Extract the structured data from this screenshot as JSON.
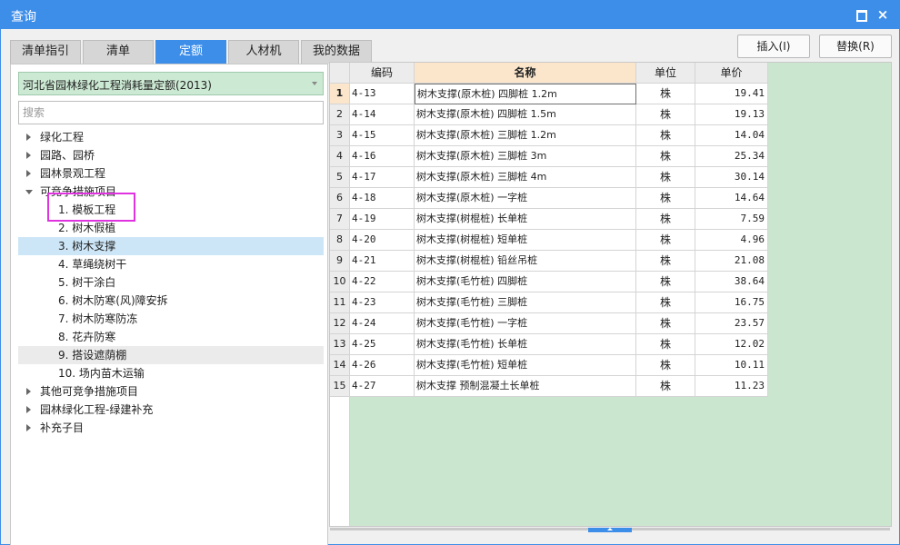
{
  "window": {
    "title": "查询",
    "maximize_icon": "maximize-icon",
    "close_icon": "close-icon",
    "close_glyph": "×"
  },
  "tabs": [
    {
      "label": "清单指引",
      "active": false
    },
    {
      "label": "清单",
      "active": false
    },
    {
      "label": "定额",
      "active": true
    },
    {
      "label": "人材机",
      "active": false
    },
    {
      "label": "我的数据",
      "active": false
    }
  ],
  "actions": {
    "insert_label": "插入(I)",
    "replace_label": "替换(R)"
  },
  "library": {
    "selected": "河北省园林绿化工程消耗量定额(2013)"
  },
  "search": {
    "placeholder": "搜索",
    "value": ""
  },
  "tree": [
    {
      "label": "绿化工程",
      "level": 0,
      "state": "collapsed"
    },
    {
      "label": "园路、园桥",
      "level": 0,
      "state": "collapsed"
    },
    {
      "label": "园林景观工程",
      "level": 0,
      "state": "collapsed"
    },
    {
      "label": "可竞争措施项目",
      "level": 0,
      "state": "expanded"
    },
    {
      "label": "1. 模板工程",
      "level": 1
    },
    {
      "label": "2. 树木假植",
      "level": 1
    },
    {
      "label": "3. 树木支撑",
      "level": 1,
      "selected": true
    },
    {
      "label": "4. 草绳绕树干",
      "level": 1
    },
    {
      "label": "5. 树干涂白",
      "level": 1
    },
    {
      "label": "6. 树木防寒(风)障安拆",
      "level": 1
    },
    {
      "label": "7. 树木防寒防冻",
      "level": 1
    },
    {
      "label": "8. 花卉防寒",
      "level": 1
    },
    {
      "label": "9. 搭设遮荫棚",
      "level": 1,
      "hover": true
    },
    {
      "label": "10. 场内苗木运输",
      "level": 1
    },
    {
      "label": "其他可竞争措施项目",
      "level": 0,
      "state": "collapsed"
    },
    {
      "label": "园林绿化工程-绿建补充",
      "level": 0,
      "state": "collapsed"
    },
    {
      "label": "补充子目",
      "level": 0,
      "state": "collapsed"
    }
  ],
  "grid": {
    "columns": [
      "编码",
      "名称",
      "单位",
      "单价"
    ],
    "current_row": 1,
    "rows": [
      {
        "no": "1",
        "code": "4-13",
        "name": "树木支撑(原木桩) 四脚桩 1.2m",
        "unit": "株",
        "price": "19.41"
      },
      {
        "no": "2",
        "code": "4-14",
        "name": "树木支撑(原木桩) 四脚桩 1.5m",
        "unit": "株",
        "price": "19.13"
      },
      {
        "no": "3",
        "code": "4-15",
        "name": "树木支撑(原木桩) 三脚桩 1.2m",
        "unit": "株",
        "price": "14.04"
      },
      {
        "no": "4",
        "code": "4-16",
        "name": "树木支撑(原木桩) 三脚桩 3m",
        "unit": "株",
        "price": "25.34"
      },
      {
        "no": "5",
        "code": "4-17",
        "name": "树木支撑(原木桩) 三脚桩 4m",
        "unit": "株",
        "price": "30.14"
      },
      {
        "no": "6",
        "code": "4-18",
        "name": "树木支撑(原木桩) 一字桩",
        "unit": "株",
        "price": "14.64"
      },
      {
        "no": "7",
        "code": "4-19",
        "name": "树木支撑(树棍桩) 长单桩",
        "unit": "株",
        "price": "7.59"
      },
      {
        "no": "8",
        "code": "4-20",
        "name": "树木支撑(树棍桩) 短单桩",
        "unit": "株",
        "price": "4.96"
      },
      {
        "no": "9",
        "code": "4-21",
        "name": "树木支撑(树棍桩) 铅丝吊桩",
        "unit": "株",
        "price": "21.08"
      },
      {
        "no": "10",
        "code": "4-22",
        "name": "树木支撑(毛竹桩) 四脚桩",
        "unit": "株",
        "price": "38.64"
      },
      {
        "no": "11",
        "code": "4-23",
        "name": "树木支撑(毛竹桩) 三脚桩",
        "unit": "株",
        "price": "16.75"
      },
      {
        "no": "12",
        "code": "4-24",
        "name": "树木支撑(毛竹桩) 一字桩",
        "unit": "株",
        "price": "23.57"
      },
      {
        "no": "13",
        "code": "4-25",
        "name": "树木支撑(毛竹桩) 长单桩",
        "unit": "株",
        "price": "12.02"
      },
      {
        "no": "14",
        "code": "4-26",
        "name": "树木支撑(毛竹桩) 短单桩",
        "unit": "株",
        "price": "10.11"
      },
      {
        "no": "15",
        "code": "4-27",
        "name": "树木支撑 预制混凝土长单桩",
        "unit": "株",
        "price": "11.23"
      }
    ]
  },
  "colors": {
    "accent": "#3d8ee9",
    "grid_bg": "#cbe6ce",
    "selected_row": "#cde6f7",
    "annotation": "#e033e0"
  }
}
